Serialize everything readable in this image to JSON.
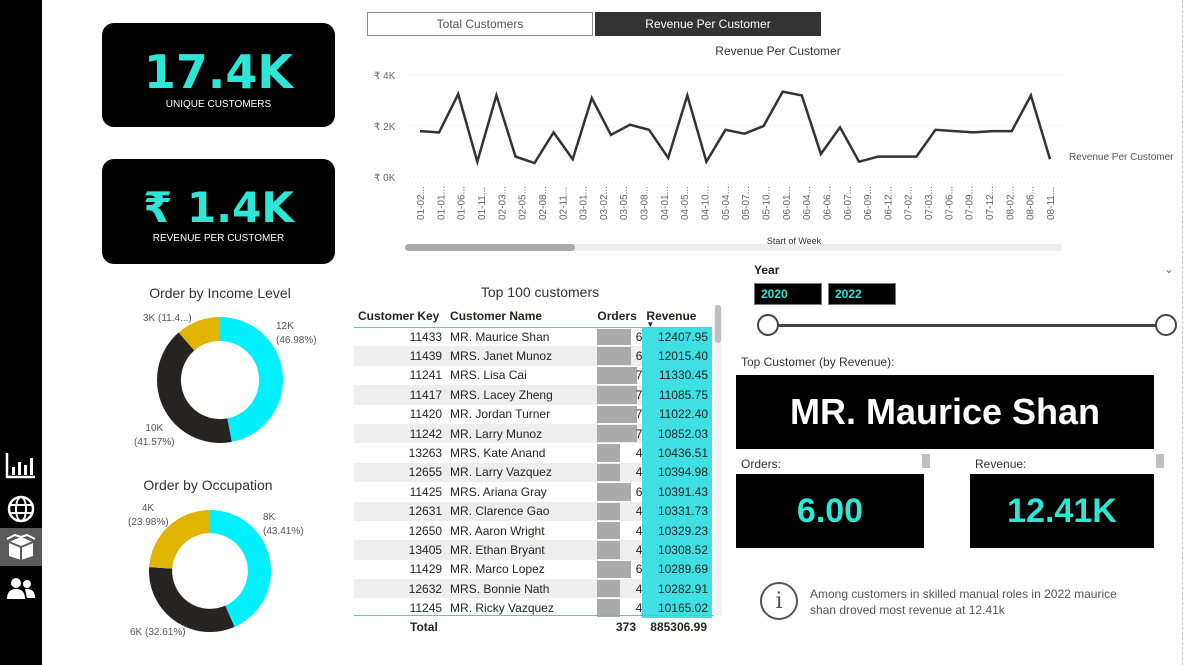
{
  "kpis": {
    "unique_customers": {
      "value": "17.4K",
      "label": "UNIQUE CUSTOMERS"
    },
    "revenue_per_customer": {
      "value": "₹ 1.4K",
      "label": "REVENUE PER CUSTOMER"
    }
  },
  "tabs": [
    {
      "label": "Total Customers",
      "active": false
    },
    {
      "label": "Revenue Per Customer",
      "active": true
    }
  ],
  "line_chart": {
    "title": "Revenue Per Customer",
    "legend": "Revenue Per Customer",
    "xlabel": "Start of Week",
    "y_ticks": [
      "₹ 4K",
      "₹ 2K",
      "₹ 0K"
    ],
    "x_ticks": [
      "01-02...",
      "01-01...",
      "01-06...",
      "01-11...",
      "02-03...",
      "02-05...",
      "02-08...",
      "02-11...",
      "03-01...",
      "03-02...",
      "03-05...",
      "03-08...",
      "04-01...",
      "04-05...",
      "04-10...",
      "05-04...",
      "05-07...",
      "05-10...",
      "06-01...",
      "06-04...",
      "06-06...",
      "06-07...",
      "06-09...",
      "06-12...",
      "07-02...",
      "07-03...",
      "07-06...",
      "07-09...",
      "07-12...",
      "08-02...",
      "08-06...",
      "08-11..."
    ],
    "color": "#333333"
  },
  "chart_data": [
    {
      "type": "line",
      "title": "Revenue Per Customer",
      "xlabel": "Start of Week",
      "ylabel": "",
      "ylim": [
        0,
        4500
      ],
      "series": [
        {
          "name": "Revenue Per Customer",
          "values": [
            1800,
            1750,
            3250,
            600,
            3200,
            800,
            550,
            1750,
            700,
            3100,
            1650,
            2050,
            1850,
            750,
            3200,
            600,
            1850,
            1700,
            2000,
            3350,
            3200,
            900,
            1950,
            600,
            800,
            800,
            800,
            1850,
            1800,
            1750,
            1800,
            1800,
            3200,
            700
          ]
        }
      ]
    },
    {
      "type": "pie",
      "title": "Order by Income Level",
      "categories": [
        "12K",
        "10K",
        "3K"
      ],
      "values": [
        46.98,
        41.57,
        11.4
      ],
      "labels": [
        "12K\n(46.98%)",
        "10K\n(41.57%)",
        "3K (11.4...)"
      ],
      "colors": [
        "#00f0ff",
        "#252423",
        "#e0b400"
      ]
    },
    {
      "type": "pie",
      "title": "Order by Occupation",
      "categories": [
        "8K",
        "6K",
        "4K"
      ],
      "values": [
        43.41,
        32.61,
        23.98
      ],
      "colors": [
        "#00f0ff",
        "#252423",
        "#e0b400"
      ]
    }
  ],
  "donut_income": {
    "title": "Order by Income Level",
    "labels": [
      {
        "line1": "12K",
        "line2": "(46.98%)"
      },
      {
        "line1": "10K",
        "line2": "(41.57%)"
      },
      {
        "line1": "3K (11.4...)",
        "line2": ""
      }
    ]
  },
  "donut_occupation": {
    "title": "Order by Occupation",
    "labels": [
      {
        "line1": "8K",
        "line2": "(43.41%)"
      },
      {
        "line1": "6K (32.61%)",
        "line2": ""
      },
      {
        "line1": "4K",
        "line2": "(23.98%)"
      }
    ]
  },
  "table": {
    "title": "Top 100 customers",
    "headers": {
      "key": "Customer Key",
      "name": "Customer Name",
      "orders": "Orders",
      "revenue": "Revenue"
    },
    "rows": [
      {
        "key": "11433",
        "name": "MR. Maurice Shan",
        "orders": "6",
        "revenue": "12407.95",
        "orders_fraction": 0.86
      },
      {
        "key": "11439",
        "name": "MRS. Janet Munoz",
        "orders": "6",
        "revenue": "12015.40",
        "orders_fraction": 0.86
      },
      {
        "key": "11241",
        "name": "MRS. Lisa Cai",
        "orders": "7",
        "revenue": "11330.45",
        "orders_fraction": 1.0
      },
      {
        "key": "11417",
        "name": "MRS. Lacey Zheng",
        "orders": "7",
        "revenue": "11085.75",
        "orders_fraction": 1.0
      },
      {
        "key": "11420",
        "name": "MR. Jordan Turner",
        "orders": "7",
        "revenue": "11022.40",
        "orders_fraction": 1.0
      },
      {
        "key": "11242",
        "name": "MR. Larry Munoz",
        "orders": "7",
        "revenue": "10852.03",
        "orders_fraction": 1.0
      },
      {
        "key": "13263",
        "name": "MRS. Kate Anand",
        "orders": "4",
        "revenue": "10436.51",
        "orders_fraction": 0.57
      },
      {
        "key": "12655",
        "name": "MR. Larry Vazquez",
        "orders": "4",
        "revenue": "10394.98",
        "orders_fraction": 0.57
      },
      {
        "key": "11425",
        "name": "MRS. Ariana Gray",
        "orders": "6",
        "revenue": "10391.43",
        "orders_fraction": 0.86
      },
      {
        "key": "12631",
        "name": "MR. Clarence Gao",
        "orders": "4",
        "revenue": "10331.73",
        "orders_fraction": 0.57
      },
      {
        "key": "12650",
        "name": "MR. Aaron Wright",
        "orders": "4",
        "revenue": "10329.23",
        "orders_fraction": 0.57
      },
      {
        "key": "13405",
        "name": "MR. Ethan Bryant",
        "orders": "4",
        "revenue": "10308.52",
        "orders_fraction": 0.57
      },
      {
        "key": "11429",
        "name": "MR. Marco Lopez",
        "orders": "6",
        "revenue": "10289.69",
        "orders_fraction": 0.86
      },
      {
        "key": "12632",
        "name": "MRS. Bonnie Nath",
        "orders": "4",
        "revenue": "10282.91",
        "orders_fraction": 0.57
      },
      {
        "key": "11245",
        "name": "MR. Ricky Vazquez",
        "orders": "4",
        "revenue": "10165.02",
        "orders_fraction": 0.57
      }
    ],
    "total": {
      "label": "Total",
      "orders": "373",
      "revenue": "885306.99"
    }
  },
  "year_filter": {
    "label": "Year",
    "from": "2020",
    "to": "2022"
  },
  "top_customer": {
    "label": "Top Customer (by Revenue):",
    "name": "MR. Maurice Shan",
    "orders_label": "Orders:",
    "orders_value": "6.00",
    "revenue_label": "Revenue:",
    "revenue_value": "12.41K"
  },
  "insight": {
    "icon": "info-icon",
    "text": "Among customers in skilled manual roles in 2022 maurice shan droved most revenue at 12.41k"
  },
  "sidebar": {
    "icons": [
      "bar-chart-icon",
      "globe-icon",
      "box-icon",
      "users-icon"
    ]
  },
  "colors": {
    "accent": "#2ee6d6",
    "cyan": "#00f0ff",
    "dark": "#252423",
    "gold": "#e0b400",
    "revenue_bg": "#3fe0e4"
  }
}
